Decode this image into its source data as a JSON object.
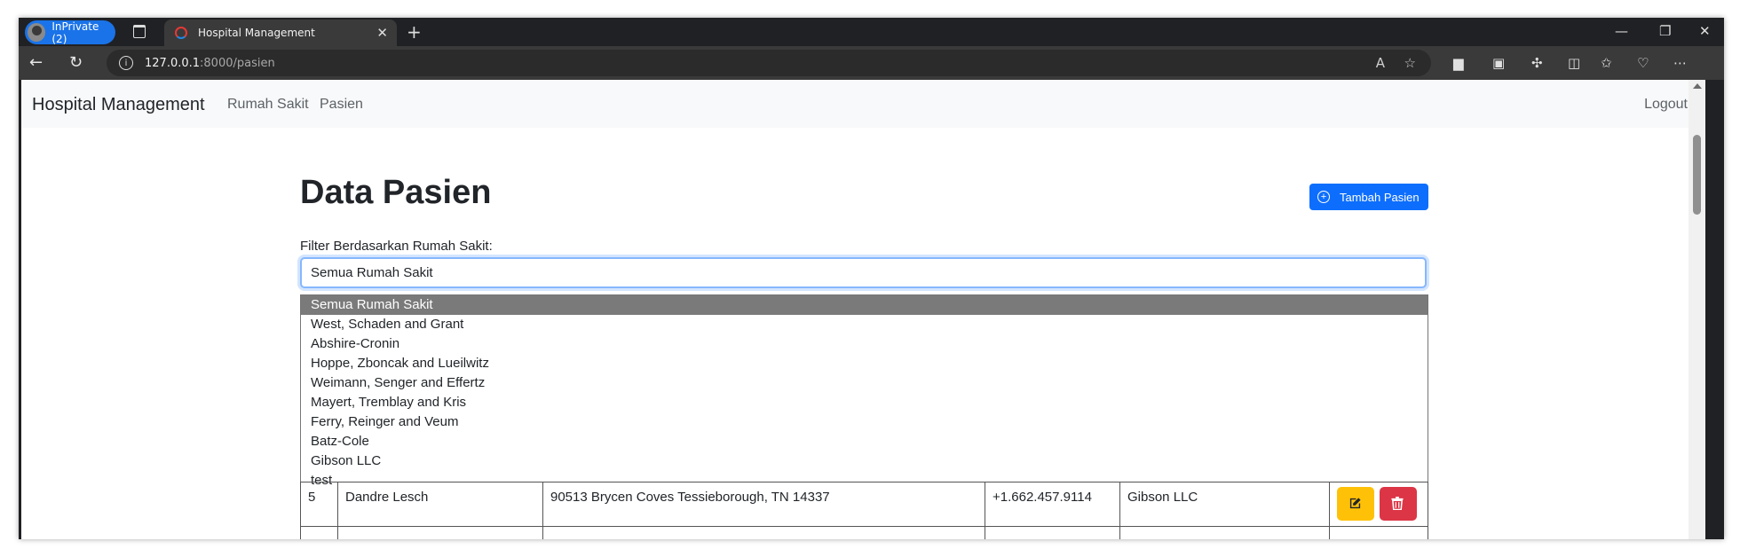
{
  "browser": {
    "inprivate_label": "InPrivate (2)",
    "tab_title": "Hospital Management",
    "url_host": "127.0.0.1",
    "url_path": ":8000/pasien"
  },
  "navbar": {
    "brand": "Hospital Management",
    "links": [
      "Rumah Sakit",
      "Pasien"
    ],
    "logout": "Logout"
  },
  "main": {
    "title": "Data Pasien",
    "add_button": "Tambah Pasien",
    "filter_label": "Filter Berdasarkan Rumah Sakit:",
    "filter_value": "Semua Rumah Sakit",
    "filter_options": [
      "Semua Rumah Sakit",
      "West, Schaden and Grant",
      "Abshire-Cronin",
      "Hoppe, Zboncak and Lueilwitz",
      "Weimann, Senger and Effertz",
      "Mayert, Tremblay and Kris",
      "Ferry, Reinger and Veum",
      "Batz-Cole",
      "Gibson LLC",
      "test"
    ],
    "table_row": {
      "id": "5",
      "name": "Dandre Lesch",
      "address": "90513 Brycen Coves Tessieborough, TN 14337",
      "phone": "+1.662.457.9114",
      "hospital": "Gibson LLC"
    }
  },
  "colors": {
    "primary": "#0d6efd",
    "warning": "#ffc107",
    "danger": "#dc3545"
  }
}
